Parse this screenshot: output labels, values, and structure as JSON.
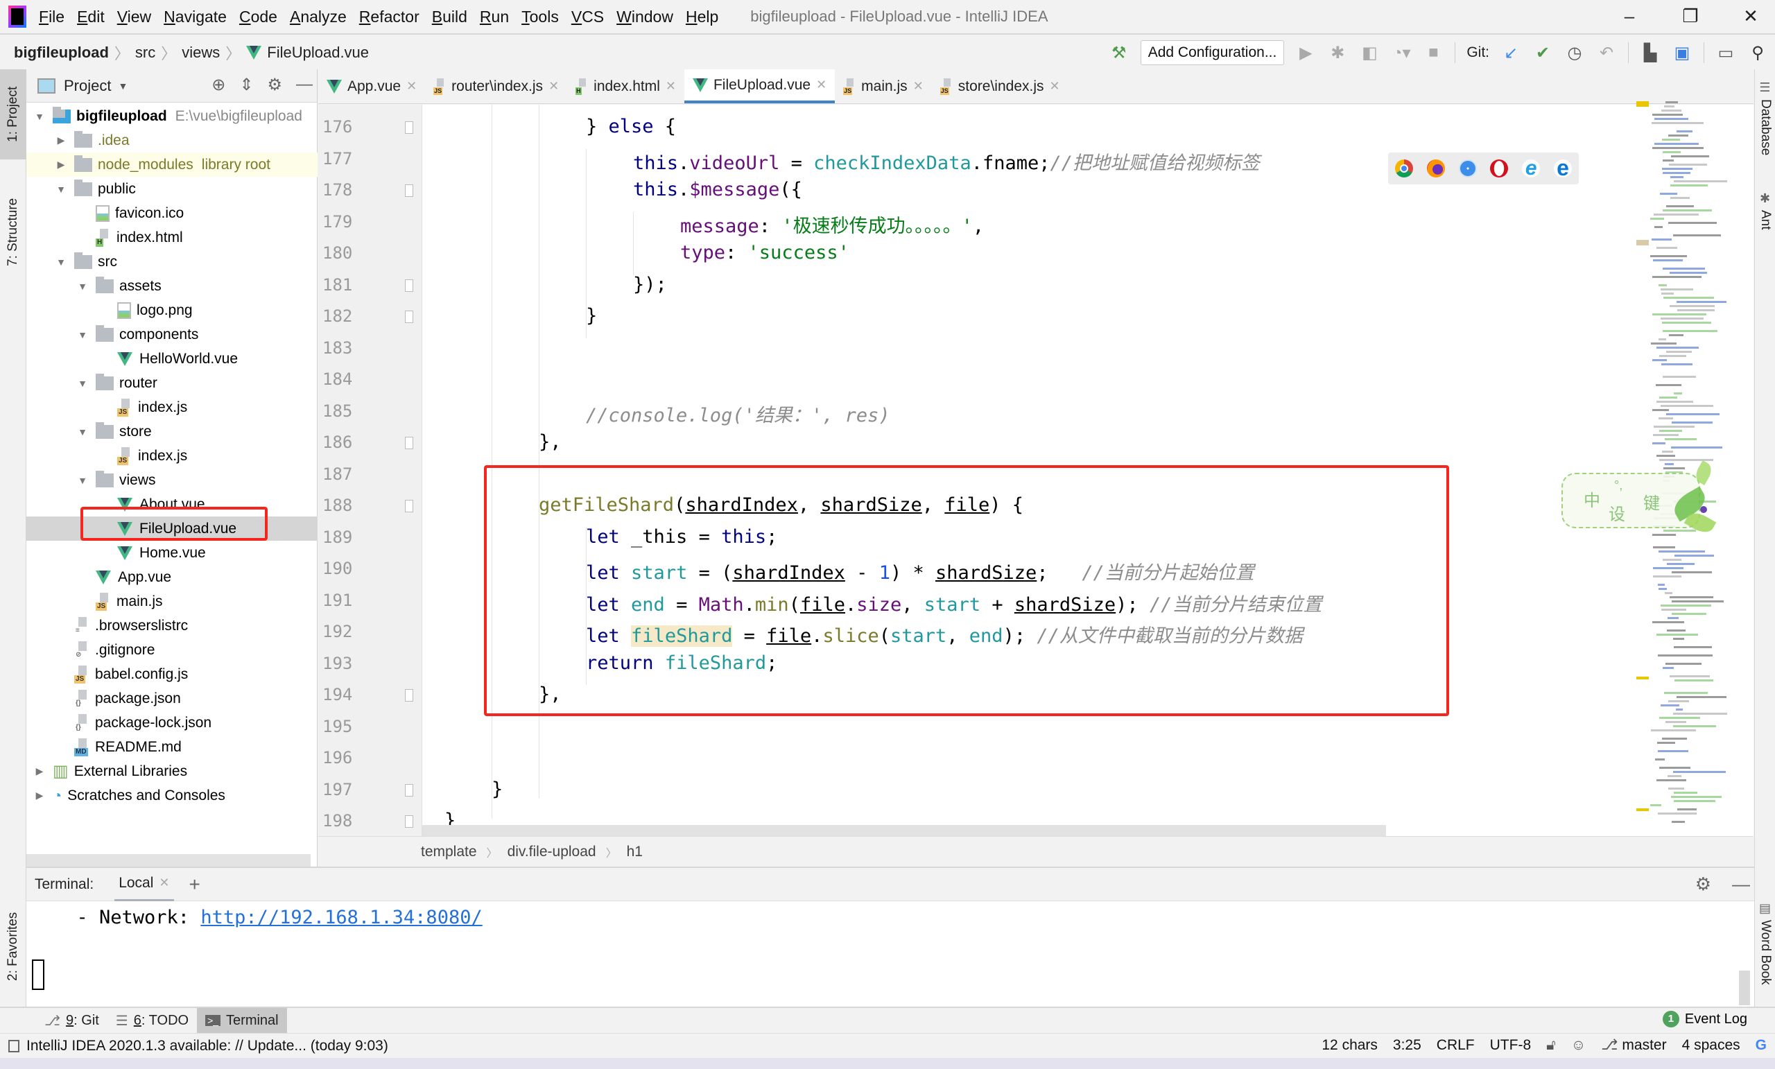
{
  "menubar": {
    "items": [
      "File",
      "Edit",
      "View",
      "Navigate",
      "Code",
      "Analyze",
      "Refactor",
      "Build",
      "Run",
      "Tools",
      "VCS",
      "Window",
      "Help"
    ],
    "window_title": "bigfileupload - FileUpload.vue - IntelliJ IDEA"
  },
  "navbar": {
    "breadcrumb": [
      "bigfileupload",
      "src",
      "views",
      "FileUpload.vue"
    ],
    "add_configuration": "Add Configuration...",
    "git_label": "Git:"
  },
  "left_stripe": {
    "project": "1: Project",
    "structure": "7: Structure",
    "favorites": "2: Favorites"
  },
  "right_stripe": {
    "database": "Database",
    "ant": "Ant",
    "word_book": "Word Book"
  },
  "project_panel": {
    "title": "Project",
    "tree": [
      {
        "label": "bigfileupload",
        "extra": "E:\\vue\\bigfileupload",
        "type": "project",
        "depth": 0,
        "expanded": true
      },
      {
        "label": ".idea",
        "type": "folder",
        "depth": 1,
        "expanded": false
      },
      {
        "label": "node_modules",
        "extra": "library root",
        "type": "folder",
        "depth": 1,
        "expanded": false
      },
      {
        "label": "public",
        "type": "folder",
        "depth": 1,
        "expanded": true
      },
      {
        "label": "favicon.ico",
        "type": "image",
        "depth": 2
      },
      {
        "label": "index.html",
        "type": "html",
        "depth": 2
      },
      {
        "label": "src",
        "type": "folder",
        "depth": 1,
        "expanded": true
      },
      {
        "label": "assets",
        "type": "folder",
        "depth": 2,
        "expanded": true
      },
      {
        "label": "logo.png",
        "type": "image",
        "depth": 3
      },
      {
        "label": "components",
        "type": "folder",
        "depth": 2,
        "expanded": true
      },
      {
        "label": "HelloWorld.vue",
        "type": "vue",
        "depth": 3
      },
      {
        "label": "router",
        "type": "folder",
        "depth": 2,
        "expanded": true
      },
      {
        "label": "index.js",
        "type": "js",
        "depth": 3
      },
      {
        "label": "store",
        "type": "folder",
        "depth": 2,
        "expanded": true
      },
      {
        "label": "index.js",
        "type": "js",
        "depth": 3
      },
      {
        "label": "views",
        "type": "folder",
        "depth": 2,
        "expanded": true
      },
      {
        "label": "About.vue",
        "type": "vue",
        "depth": 3
      },
      {
        "label": "FileUpload.vue",
        "type": "vue",
        "depth": 3,
        "selected": true
      },
      {
        "label": "Home.vue",
        "type": "vue",
        "depth": 3
      },
      {
        "label": "App.vue",
        "type": "vue",
        "depth": 2
      },
      {
        "label": "main.js",
        "type": "js",
        "depth": 2
      },
      {
        "label": ".browserslistrc",
        "type": "text",
        "depth": 1
      },
      {
        "label": ".gitignore",
        "type": "ignore",
        "depth": 1
      },
      {
        "label": "babel.config.js",
        "type": "js",
        "depth": 1
      },
      {
        "label": "package.json",
        "type": "json",
        "depth": 1
      },
      {
        "label": "package-lock.json",
        "type": "json",
        "depth": 1
      },
      {
        "label": "README.md",
        "type": "md",
        "depth": 1
      },
      {
        "label": "External Libraries",
        "type": "libraries",
        "depth": 0,
        "expanded": false
      },
      {
        "label": "Scratches and Consoles",
        "type": "scratches",
        "depth": 0,
        "expanded": false
      }
    ]
  },
  "editor": {
    "tabs": [
      {
        "label": "App.vue",
        "type": "vue",
        "active": false
      },
      {
        "label": "router\\index.js",
        "type": "js",
        "active": false
      },
      {
        "label": "index.html",
        "type": "html",
        "active": false
      },
      {
        "label": "FileUpload.vue",
        "type": "vue",
        "active": true
      },
      {
        "label": "main.js",
        "type": "js",
        "active": false
      },
      {
        "label": "store\\index.js",
        "type": "js",
        "active": false
      }
    ],
    "lines": [
      {
        "no": "176",
        "indent": 3,
        "tokens": [
          [
            "",
            "} "
          ],
          [
            "kw",
            "else"
          ],
          [
            "",
            " {"
          ]
        ]
      },
      {
        "no": "177",
        "indent": 4,
        "tokens": [
          [
            "kw",
            "this"
          ],
          [
            "",
            "."
          ],
          [
            "prop",
            "videoUrl"
          ],
          [
            "",
            " = "
          ],
          [
            "var",
            "checkIndexData"
          ],
          [
            "",
            ".fname;"
          ],
          [
            "cmt",
            "//把地址赋值给视频标签"
          ]
        ]
      },
      {
        "no": "178",
        "indent": 4,
        "tokens": [
          [
            "kw",
            "this"
          ],
          [
            "",
            "."
          ],
          [
            "prop",
            "$message"
          ],
          [
            "",
            "({"
          ]
        ]
      },
      {
        "no": "179",
        "indent": 5,
        "tokens": [
          [
            "prop",
            "message"
          ],
          [
            "",
            ": "
          ],
          [
            "str",
            "'极速秒传成功。。。。。'"
          ],
          [
            "",
            ","
          ]
        ]
      },
      {
        "no": "180",
        "indent": 5,
        "tokens": [
          [
            "prop",
            "type"
          ],
          [
            "",
            ": "
          ],
          [
            "str",
            "'success'"
          ]
        ]
      },
      {
        "no": "181",
        "indent": 4,
        "tokens": [
          [
            "",
            "});"
          ]
        ]
      },
      {
        "no": "182",
        "indent": 3,
        "tokens": [
          [
            "",
            "}"
          ]
        ]
      },
      {
        "no": "183",
        "indent": 0,
        "tokens": []
      },
      {
        "no": "184",
        "indent": 0,
        "tokens": []
      },
      {
        "no": "185",
        "indent": 3,
        "tokens": [
          [
            "cmt",
            "//console.log('结果：', res)"
          ]
        ]
      },
      {
        "no": "186",
        "indent": 2,
        "tokens": [
          [
            "",
            "},"
          ]
        ]
      },
      {
        "no": "187",
        "indent": 0,
        "tokens": []
      },
      {
        "no": "188",
        "indent": 2,
        "tokens": [
          [
            "fn",
            "getFileShard"
          ],
          [
            "",
            "("
          ],
          [
            "param",
            "shardIndex"
          ],
          [
            "",
            ", "
          ],
          [
            "param",
            "shardSize"
          ],
          [
            "",
            ", "
          ],
          [
            "param",
            "file"
          ],
          [
            "",
            ") {"
          ]
        ]
      },
      {
        "no": "189",
        "indent": 3,
        "tokens": [
          [
            "kw",
            "let"
          ],
          [
            "",
            " _this = "
          ],
          [
            "kw",
            "this"
          ],
          [
            "",
            ";"
          ]
        ]
      },
      {
        "no": "190",
        "indent": 3,
        "tokens": [
          [
            "kw",
            "let"
          ],
          [
            "",
            " "
          ],
          [
            "var",
            "start"
          ],
          [
            "",
            " = ("
          ],
          [
            "param",
            "shardIndex"
          ],
          [
            "",
            " - "
          ],
          [
            "num",
            "1"
          ],
          [
            "",
            ") * "
          ],
          [
            "param",
            "shardSize"
          ],
          [
            "",
            ";   "
          ],
          [
            "cmt",
            "//当前分片起始位置"
          ]
        ]
      },
      {
        "no": "191",
        "indent": 3,
        "tokens": [
          [
            "kw",
            "let"
          ],
          [
            "",
            " "
          ],
          [
            "var",
            "end"
          ],
          [
            "",
            " = "
          ],
          [
            "prop",
            "Math"
          ],
          [
            "",
            "."
          ],
          [
            "fn",
            "min"
          ],
          [
            "",
            "("
          ],
          [
            "param",
            "file"
          ],
          [
            "",
            "."
          ],
          [
            "prop",
            "size"
          ],
          [
            "",
            ", "
          ],
          [
            "var",
            "start"
          ],
          [
            "",
            " + "
          ],
          [
            "param",
            "shardSize"
          ],
          [
            "",
            "); "
          ],
          [
            "cmt",
            "//当前分片结束位置"
          ]
        ]
      },
      {
        "no": "192",
        "indent": 3,
        "tokens": [
          [
            "kw",
            "let"
          ],
          [
            "",
            " "
          ],
          [
            "var hl-ident",
            "fileShard"
          ],
          [
            "",
            " = "
          ],
          [
            "param",
            "file"
          ],
          [
            "",
            "."
          ],
          [
            "fn",
            "slice"
          ],
          [
            "",
            "("
          ],
          [
            "var",
            "start"
          ],
          [
            "",
            ", "
          ],
          [
            "var",
            "end"
          ],
          [
            "",
            "); "
          ],
          [
            "cmt",
            "//从文件中截取当前的分片数据"
          ]
        ]
      },
      {
        "no": "193",
        "indent": 3,
        "tokens": [
          [
            "kw",
            "return"
          ],
          [
            "",
            " "
          ],
          [
            "var",
            "fileShard"
          ],
          [
            "",
            ";"
          ]
        ]
      },
      {
        "no": "194",
        "indent": 2,
        "tokens": [
          [
            "",
            "},"
          ]
        ]
      },
      {
        "no": "195",
        "indent": 0,
        "tokens": []
      },
      {
        "no": "196",
        "indent": 0,
        "tokens": []
      },
      {
        "no": "197",
        "indent": 1,
        "tokens": [
          [
            "",
            "}"
          ]
        ]
      },
      {
        "no": "198",
        "indent": 0,
        "tokens": [
          [
            "",
            "}"
          ]
        ]
      }
    ],
    "breadcrumb": [
      "template",
      "div.file-upload",
      "h1"
    ]
  },
  "browser_icons": [
    "chrome-icon",
    "firefox-icon",
    "safari-icon",
    "opera-icon",
    "internet-explorer-icon",
    "edge-icon"
  ],
  "ime_widget": {
    "chars": [
      "中",
      "°,",
      "设",
      "键"
    ]
  },
  "terminal": {
    "label": "Terminal:",
    "tab": "Local",
    "line_prefix": "  - Network: ",
    "link": "http://192.168.1.34:8080/"
  },
  "tool_tabs": [
    {
      "num": "9",
      "label": ": Git"
    },
    {
      "num": "6",
      "label": ": TODO"
    },
    {
      "num": "",
      "label": "Terminal",
      "active": true
    }
  ],
  "event_log": {
    "count": "1",
    "label": "Event Log"
  },
  "status_bar": {
    "message": "IntelliJ IDEA 2020.1.3 available: // Update... (today 9:03)",
    "chars": "12 chars",
    "position": "3:25",
    "line_sep": "CRLF",
    "encoding": "UTF-8",
    "branch": "master",
    "indent": "4 spaces"
  }
}
